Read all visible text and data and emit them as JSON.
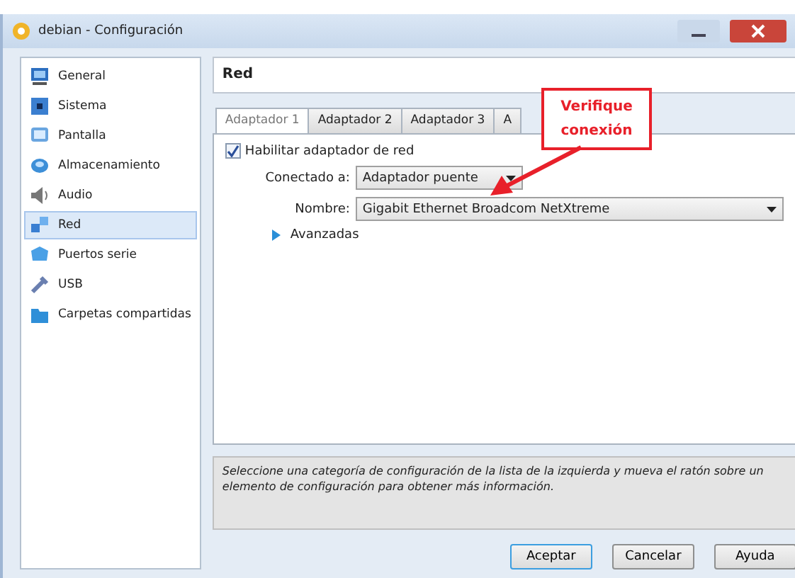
{
  "window": {
    "title": "debian - Configuración"
  },
  "sidebar": {
    "items": [
      {
        "label": "General",
        "selected": false
      },
      {
        "label": "Sistema",
        "selected": false
      },
      {
        "label": "Pantalla",
        "selected": false
      },
      {
        "label": "Almacenamiento",
        "selected": false
      },
      {
        "label": "Audio",
        "selected": false
      },
      {
        "label": "Red",
        "selected": true
      },
      {
        "label": "Puertos serie",
        "selected": false
      },
      {
        "label": "USB",
        "selected": false
      },
      {
        "label": "Carpetas compartidas",
        "selected": false
      }
    ]
  },
  "section_title": "Red",
  "tabs": [
    {
      "label": "Adaptador 1",
      "selected": true
    },
    {
      "label": "Adaptador 2",
      "selected": false
    },
    {
      "label": "Adaptador 3",
      "selected": false
    },
    {
      "label": "A",
      "selected": false
    }
  ],
  "enable_adapter": {
    "label": "Habilitar adaptador de red",
    "checked": true
  },
  "fields": [
    {
      "label": "Conectado a:",
      "value": "Adaptador puente"
    },
    {
      "label": "Nombre:",
      "value": "Gigabit Ethernet Broadcom NetXtreme"
    }
  ],
  "advanced": {
    "label": "Avanzadas"
  },
  "callout": "Verifique conexión",
  "description": "Seleccione una categoría de configuración de la lista de la izquierda y mueva el ratón sobre un elemento de configuración para obtener más información.",
  "buttons": [
    {
      "label": "Aceptar",
      "default": true
    },
    {
      "label": "Cancelar",
      "default": false
    },
    {
      "label": "Ayuda",
      "default": false
    }
  ]
}
